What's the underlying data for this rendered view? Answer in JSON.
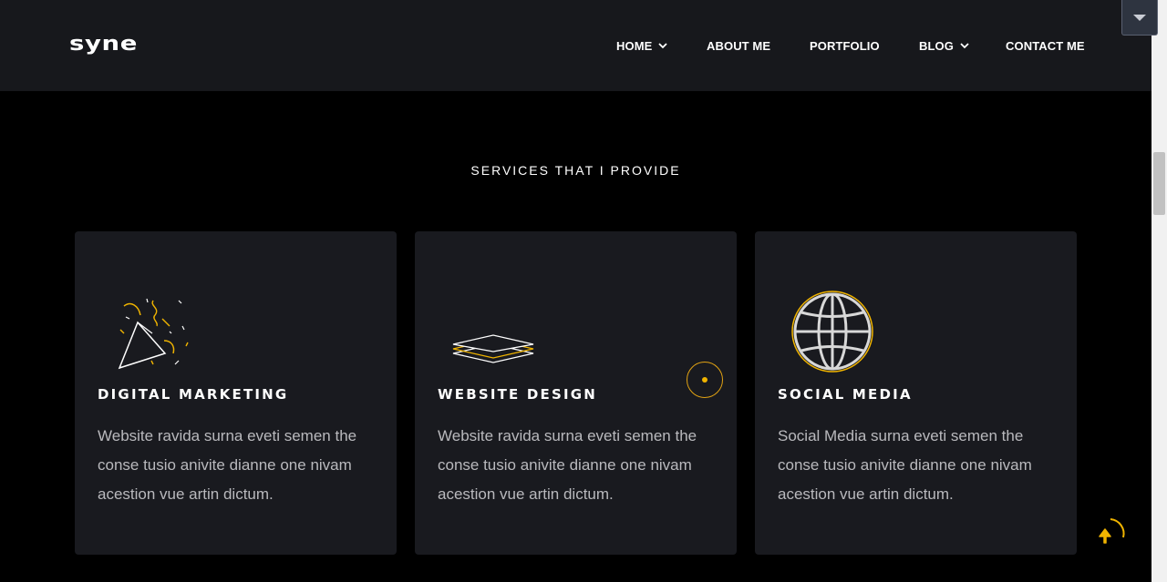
{
  "header": {
    "logo": "syne",
    "nav": {
      "home": "HOME",
      "about": "ABOUT ME",
      "portfolio": "PORTFOLIO",
      "blog": "BLOG",
      "contact": "CONTACT ME"
    }
  },
  "section": {
    "title": "SERVICES",
    "subtitle": "SERVICES THAT I PROVIDE"
  },
  "cards": [
    {
      "title": "DIGITAL MARKETING",
      "text": "Website ravida surna eveti semen the conse tusio anivite dianne one nivam acestion vue artin dictum.",
      "icon": "party-popper-icon"
    },
    {
      "title": "WEBSITE DESIGN",
      "text": "Website ravida surna eveti semen the conse tusio anivite dianne one nivam acestion vue artin dictum.",
      "icon": "layers-icon"
    },
    {
      "title": "SOCIAL MEDIA",
      "text": "Social Media surna eveti semen the conse tusio anivite dianne one nivam acestion vue artin dictum.",
      "icon": "globe-icon"
    }
  ],
  "colors": {
    "accent": "#f0b400",
    "card_bg": "#191a1f",
    "header_bg": "#17181c",
    "page_bg": "#000000"
  }
}
